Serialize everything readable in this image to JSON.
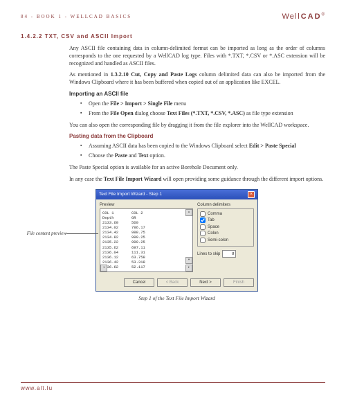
{
  "header": {
    "left": "84 - BOOK 1 - WELLCAD BASICS",
    "logo_wel": "Wel",
    "logo_l": "l",
    "logo_cad": "CAD"
  },
  "section_title": "1.4.2.2 TXT, CSV and ASCII Import",
  "p1_a": "Any ASCII file containing data in column-delimited format can be imported as long as the order of columns corresponds to the one requested by a WellCAD log type. Files with *.TXT, *.CSV or *.ASC extension will be recognized and handled as ASCII files.",
  "p2_a": "As mentioned in ",
  "p2_b": "1.3.2.10 Cut, Copy and Paste Logs",
  "p2_c": " column delimited data can also be imported from the Windows Clipboard where it has been buffered when copied out of an application like EXCEL.",
  "sub1": "Importing an ASCII file",
  "b1_a": "Open the ",
  "b1_b": "File > Import > Single File",
  "b1_c": " menu",
  "b2_a": "From the ",
  "b2_b": "File Open",
  "b2_c": " dialog choose ",
  "b2_d": "Text Files (*.TXT, *.CSV, *.ASC)",
  "b2_e": " as file type extension",
  "p3": "You can also open the corresponding file by dragging it from the file explorer into the WellCAD workspace.",
  "sub2": "Pasting data from the Clipboard",
  "b3_a": "Assuming ASCII data has been copied to the Windows Clipboard select ",
  "b3_b": "Edit > Paste Special",
  "b4_a": "Choose the ",
  "b4_b": "Paste",
  "b4_c": " and ",
  "b4_d": "Text",
  "b4_e": " option.",
  "p4": "The Paste Special option is available for an active Borehole Document only.",
  "p5_a": "In any case the ",
  "p5_b": "Text File Import Wizard",
  "p5_c": " will open providing some guidance through the different import options.",
  "annot": "File content preview",
  "wizard": {
    "title": "Text File Import Wizard - Step 1",
    "preview_label": "Preview",
    "col1": "COL 1",
    "col2": "COL 2",
    "rows": [
      [
        "Depth",
        "GR"
      ],
      [
        "2133.60",
        "560"
      ],
      [
        "2134.02",
        "786.17"
      ],
      [
        "2134.42",
        "988.75"
      ],
      [
        "2134.82",
        "999.25"
      ],
      [
        "2135.22",
        "999.25"
      ],
      [
        "2135.62",
        "697.11"
      ],
      [
        "2136.04",
        "111.31"
      ],
      [
        "2136.12",
        "63.758"
      ],
      [
        "2136.42",
        "53.318"
      ],
      [
        "2136.62",
        "52.117"
      ]
    ],
    "delim_label": "Column delimiters",
    "chk": [
      {
        "label": "Comma",
        "checked": false
      },
      {
        "label": "Tab",
        "checked": true
      },
      {
        "label": "Space",
        "checked": false
      },
      {
        "label": "Colon",
        "checked": false
      },
      {
        "label": "Semi-colon",
        "checked": false
      }
    ],
    "skip_label": "Lines to skip",
    "skip_val": "0",
    "btns": {
      "cancel": "Cancel",
      "back": "< Back",
      "next": "Next >",
      "finish": "Finish"
    }
  },
  "caption": "Step 1 of the Text File Import Wizard",
  "footer": "www.alt.lu"
}
